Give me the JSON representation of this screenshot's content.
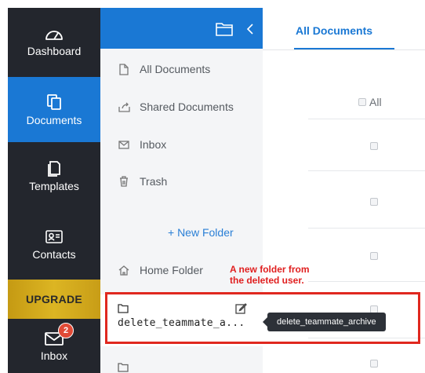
{
  "nav": {
    "dashboard": "Dashboard",
    "documents": "Documents",
    "templates": "Templates",
    "contacts": "Contacts",
    "upgrade": "UPGRADE",
    "inbox": "Inbox",
    "inbox_badge": "2"
  },
  "panel": {
    "items": [
      "All Documents",
      "Shared Documents",
      "Inbox",
      "Trash"
    ],
    "new_folder": "+ New Folder",
    "home_folder": "Home Folder",
    "folder_name": "delete_teammate_a..."
  },
  "main": {
    "tab": "All Documents",
    "select_all": "All"
  },
  "annotation": {
    "line1": "A new folder from",
    "line2": "the deleted user."
  },
  "tooltip": "delete_teammate_archive",
  "colors": {
    "nav_bg": "#23262d",
    "accent_blue": "#1a78d4",
    "upgrade_gold": "#d4ab1e",
    "annotation_red": "#e0281f",
    "badge_red": "#e04a36"
  }
}
